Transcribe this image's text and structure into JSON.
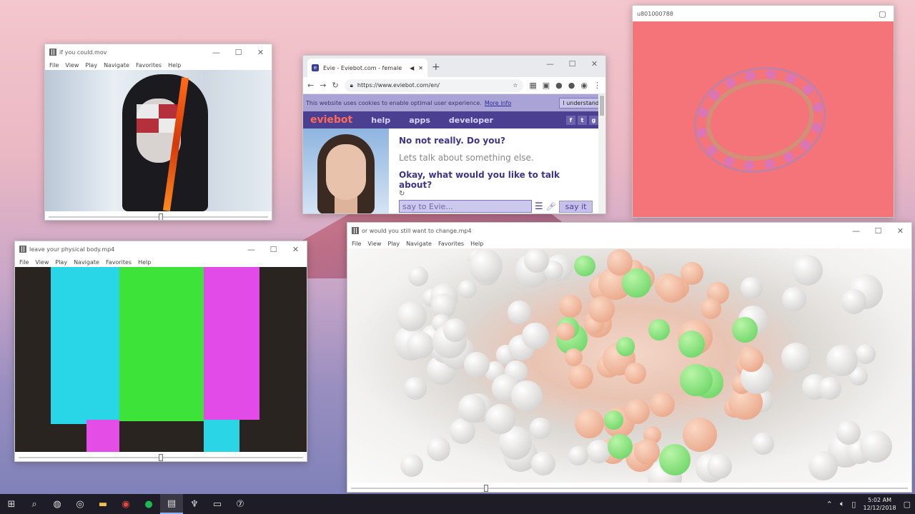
{
  "desktop": {
    "accent": "#f4c6cd"
  },
  "win1": {
    "title": "if you could.mov",
    "menu": [
      "File",
      "View",
      "Play",
      "Navigate",
      "Favorites",
      "Help"
    ],
    "progress": 0.51
  },
  "win2": {
    "title": "leave your physical body.mp4",
    "menu": [
      "File",
      "View",
      "Play",
      "Navigate",
      "Favorites",
      "Help"
    ],
    "progress": 0.5
  },
  "win3": {
    "title": "or would you still want to change.mp4",
    "menu": [
      "File",
      "View",
      "Play",
      "Navigate",
      "Favorites",
      "Help"
    ],
    "progress": 0.24
  },
  "win4": {
    "title": "u801000788"
  },
  "chrome": {
    "tab_title": "Evie - Eviebot.com - female",
    "url": "https://www.eviebot.com/en/",
    "cookie_text": "This website uses cookies to enable optimal user experience.",
    "cookie_link": "More info",
    "cookie_button": "I understand",
    "nav": {
      "logo": "eviebot",
      "items": [
        "help",
        "apps",
        "developer"
      ]
    },
    "chat": {
      "user_line": "No not really. Do you?",
      "reply": "Lets talk about something else.",
      "bot_line": "Okay, what would you like to talk about?",
      "input_placeholder": "say to Evie...",
      "send": "say it"
    }
  },
  "taskbar": {
    "icons": [
      "windows-icon",
      "search-icon",
      "discord-icon",
      "steam-icon",
      "folder-icon",
      "chrome-icon",
      "spotify-icon",
      "media-player-icon",
      "mask-icon",
      "display-icon",
      "seven-icon"
    ],
    "time": "5:02 AM",
    "date": "12/12/2018"
  }
}
